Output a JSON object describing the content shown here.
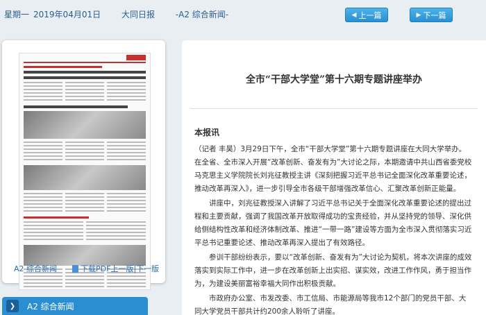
{
  "header": {
    "weekday": "星期一",
    "date": "2019年04月01日",
    "paper": "大同日报",
    "section": "-A2 综合新闻-",
    "prev_label": "上一篇",
    "next_label": "下一篇",
    "accent_color": "#2a8fd2"
  },
  "thumbnail": {
    "section_label": "A2 综合新闻",
    "pdf_label": "下载PDF",
    "prev_page": "上一版",
    "separator": "|",
    "next_page": "下一版"
  },
  "section_tab": {
    "label": "A2 综合新闻",
    "icon": "chevron-right-icon"
  },
  "article": {
    "title": "全市“干部大学堂”第十六期专题讲座举办",
    "dateline": "本报讯",
    "paragraphs": [
      "（记者 丰昊）3月29日下午，全市“干部大学堂”第十六期专题讲座在大同大学举办。在全省、全市深入开展“改革创新、奋发有为”大讨论之际，本期邀请中共山西省委党校马克思主义学院院长刘兆征教授主讲《深刻把握习近平总书记全面深化改革重要论述，推动改革再深入》，进一步引导全市各级干部增强改革信心、汇聚改革创新正能量。",
      "讲座中，刘兆征教授深入讲解了习近平总书记关于全面深化改革重要论述的提出过程和主要贡献，强调了我国改革开放取得成功的宝贵经验，并从坚持党的领导、深化供给侧结构性改革和经济体制改革、推进“一带一路”建设等方面为全市深入贯彻落实习近平总书记重要论述、推动改革再深入提出了有效路径。",
      "参训干部纷纷表示，要以“改革创新、奋发有为”大讨论为契机，将本次讲座的成效落实到实际工作中，进一步在改革创新上出实招、谋实效，改进工作作风，勇于担当作为，为建设美丽富裕幸福大同作出积极贡献。",
      "市政府办公室、市发改委、市工信局、市能源局等我市12个部门的党员干部、大同大学党员干部共计约200余人聆听了讲座。"
    ]
  }
}
